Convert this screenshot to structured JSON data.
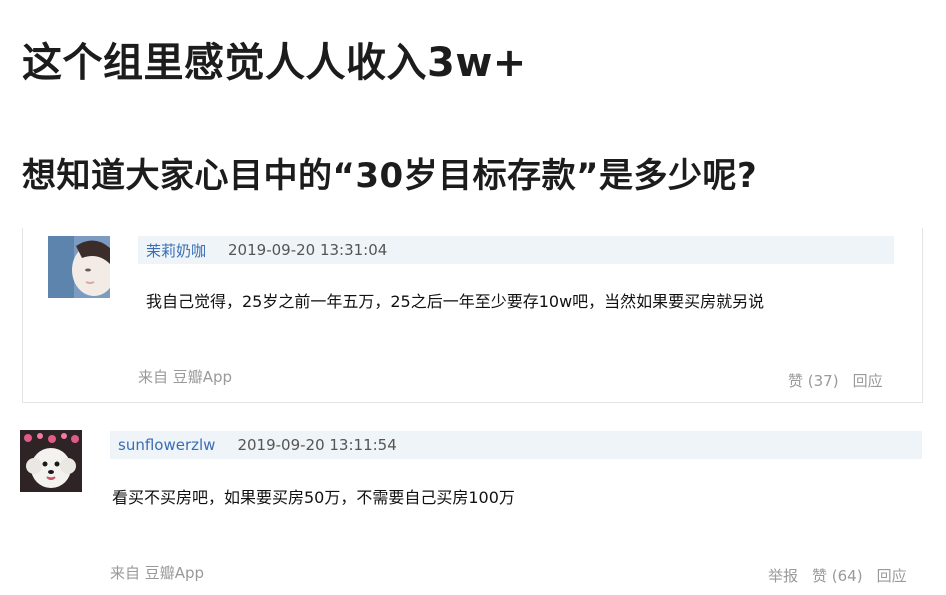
{
  "headline": {
    "line1": "这个组里感觉人人收入3w+",
    "line2": "想知道大家心目中的“30岁目标存款”是多少呢?"
  },
  "comments": [
    {
      "author": "茉莉奶咖",
      "time": "2019-09-20 13:31:04",
      "text": "我自己觉得，25岁之前一年五万，25之后一年至少要存10w吧，当然如果要买房就另说",
      "source": "来自 豆瓣App",
      "like": "赞 (37)",
      "reply": "回应"
    },
    {
      "author": "sunflowerzlw",
      "time": "2019-09-20 13:11:54",
      "text": "看买不买房吧，如果要买房50万，不需要自己买房100万",
      "source": "来自 豆瓣App",
      "report": "举报",
      "like": "赞 (64)",
      "reply": "回应"
    }
  ]
}
